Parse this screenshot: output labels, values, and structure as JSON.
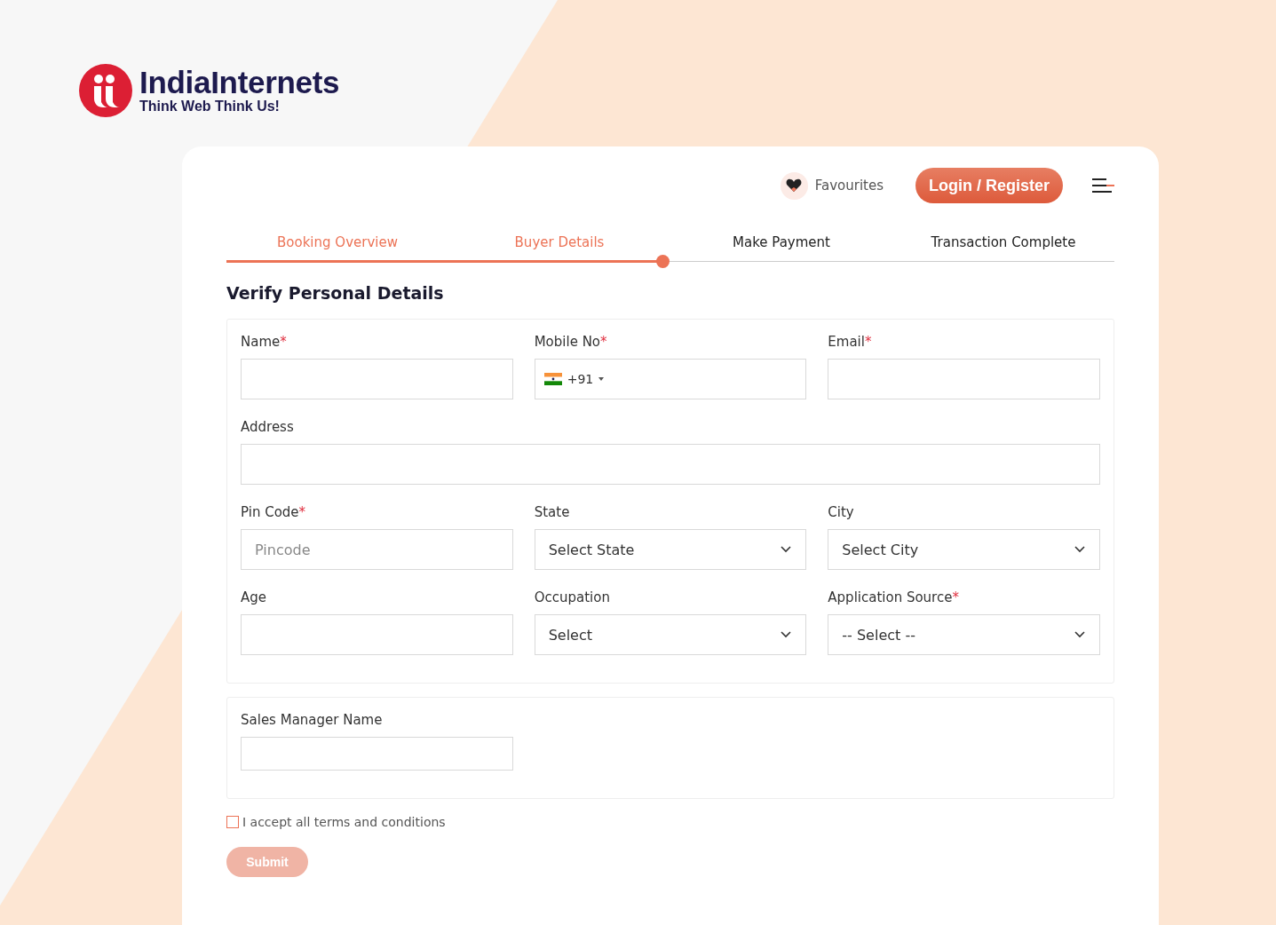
{
  "brand": {
    "name": "IndiaInternets",
    "tagline": "Think Web Think Us!"
  },
  "header": {
    "favourites": "Favourites",
    "login": "Login / Register"
  },
  "steps": [
    {
      "label": "Booking Overview",
      "done": true
    },
    {
      "label": "Buyer Details",
      "done": true
    },
    {
      "label": "Make Payment",
      "done": false
    },
    {
      "label": "Transaction Complete",
      "done": false
    }
  ],
  "progress": {
    "level": 0.492
  },
  "heading": "Verify Personal Details",
  "fields": [
    {
      "kind": "text",
      "label": "Name",
      "required_mark": "*"
    },
    {
      "kind": "phone",
      "label": "Mobile No",
      "required_mark": "*",
      "code": "+91"
    },
    {
      "kind": "text",
      "label": "Email",
      "required_mark": "*"
    },
    {
      "kind": "wide_text",
      "label": "Address"
    },
    {
      "kind": "text",
      "label": "Pin Code",
      "required_mark": "*",
      "placeholder": "Pincode"
    },
    {
      "kind": "select",
      "label": "State",
      "value": "Select State"
    },
    {
      "kind": "select",
      "label": "City",
      "value": "Select City"
    },
    {
      "kind": "text",
      "label": "Age"
    },
    {
      "kind": "select",
      "label": "Occupation",
      "value": "Select"
    },
    {
      "kind": "select",
      "label": "Application Source",
      "required_mark": "*",
      "value": "-- Select --"
    }
  ],
  "sales_manager": {
    "label": "Sales Manager Name"
  },
  "terms": {
    "label": "I accept all terms and conditions",
    "checked": false
  },
  "submit": {
    "label": "Submit",
    "disabled": true
  }
}
